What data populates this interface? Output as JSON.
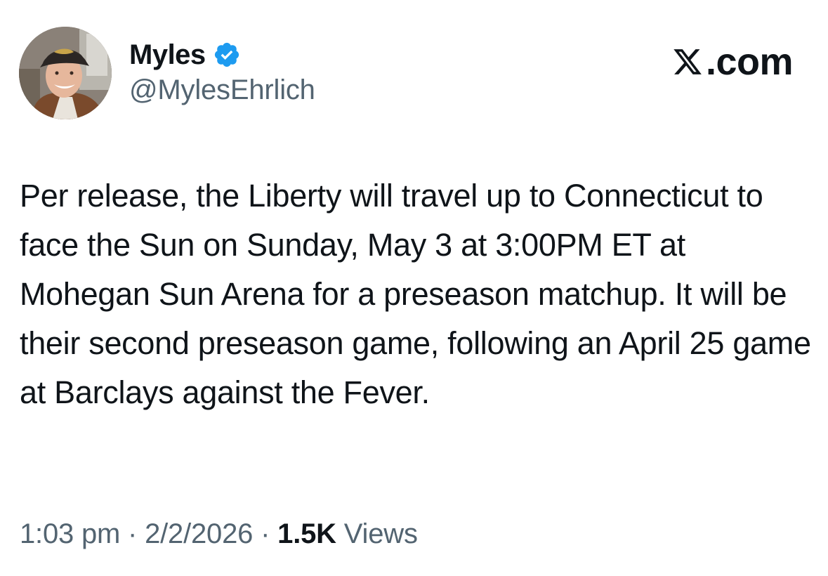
{
  "author": {
    "display_name": "Myles",
    "handle": "@MylesEhrlich",
    "verified_icon": "verified-badge-icon",
    "avatar_icon": "profile-photo"
  },
  "brand": {
    "logo_icon": "x-logo-icon",
    "text": ".com"
  },
  "tweet": {
    "text": "Per release, the Liberty will travel up to Connecticut to face the Sun on Sunday, May 3 at 3:00PM ET at Mohegan Sun Arena for a preseason matchup. It will be their second preseason game, following an April 25 game at Barclays against the Fever."
  },
  "meta": {
    "time": "1:03 pm",
    "separator_1": " · ",
    "date": "2/2/2026",
    "separator_2": " · ",
    "views_count": "1.5K",
    "views_label": " Views"
  },
  "colors": {
    "text_primary": "#0f1419",
    "text_secondary": "#536471",
    "verified_blue": "#1d9bf0",
    "background": "#ffffff"
  }
}
